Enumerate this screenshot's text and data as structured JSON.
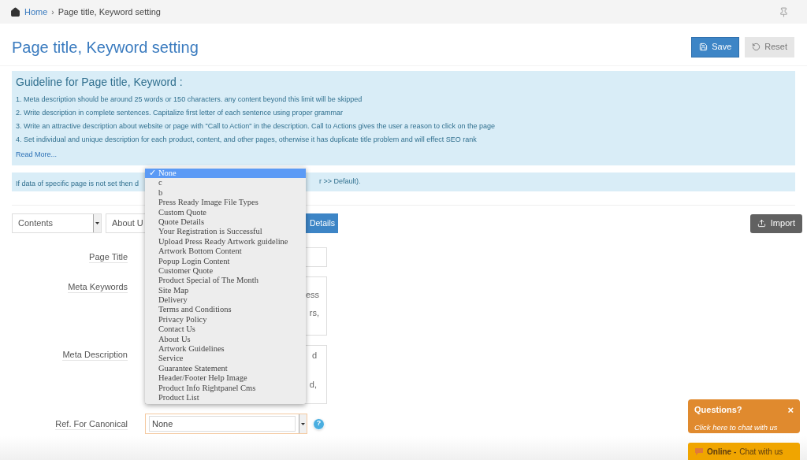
{
  "breadcrumb": {
    "home": "Home",
    "separator": "›",
    "current": "Page title, Keyword setting"
  },
  "title": "Page title, Keyword setting",
  "buttons": {
    "save": "Save",
    "reset": "Reset",
    "import": "Import",
    "details": "Details"
  },
  "guideline": {
    "heading": "Guideline for Page title, Keyword :",
    "items": [
      "1. Meta description should be around 25 words or 150 characters. any content beyond this limit will be skipped",
      "2. Write description in complete sentences. Capitalize first letter of each sentence using proper grammar",
      "3. Write an attractive description about website or page with \"Call to Action\" in the description. Call to Actions gives the user a reason to click on the page",
      "4. Set individual and unique description for each product, content, and other pages, otherwise it has duplicate title problem and will effect SEO rank"
    ],
    "read_more": "Read More..."
  },
  "info": {
    "text_start": "If data of specific page is not set then d",
    "text_end": "r >> Default)."
  },
  "filters": {
    "type_select": "Contents",
    "page_select": "About U"
  },
  "form": {
    "page_title_label": "Page Title",
    "meta_keywords_label": "Meta Keywords",
    "meta_keywords_lines": [
      "ess",
      "rs,"
    ],
    "meta_description_label": "Meta Description",
    "meta_description_lines": [
      "d",
      "d,"
    ],
    "canonical_label": "Ref. For Canonical",
    "canonical_value": "None",
    "help": "?"
  },
  "dropdown": {
    "check": "✓",
    "options": [
      {
        "label": "None",
        "selected": true
      },
      {
        "label": "c",
        "selected": false
      },
      {
        "label": "b",
        "selected": false
      },
      {
        "label": "Press Ready Image File Types",
        "selected": false
      },
      {
        "label": "Custom Quote",
        "selected": false
      },
      {
        "label": "Quote Details",
        "selected": false
      },
      {
        "label": "Your Registration is Successful",
        "selected": false
      },
      {
        "label": "Upload Press Ready Artwork guideline",
        "selected": false
      },
      {
        "label": "Artwork Bottom Content",
        "selected": false
      },
      {
        "label": "Popup Login Content",
        "selected": false
      },
      {
        "label": "Customer Quote",
        "selected": false
      },
      {
        "label": "Product Special of The Month",
        "selected": false
      },
      {
        "label": "Site Map",
        "selected": false
      },
      {
        "label": "Delivery",
        "selected": false
      },
      {
        "label": "Terms and Conditions",
        "selected": false
      },
      {
        "label": "Privacy Policy",
        "selected": false
      },
      {
        "label": "Contact Us",
        "selected": false
      },
      {
        "label": "About Us",
        "selected": false
      },
      {
        "label": "Artwork Guidelines",
        "selected": false
      },
      {
        "label": "Service",
        "selected": false
      },
      {
        "label": "Guarantee Statement",
        "selected": false
      },
      {
        "label": "Header/Footer Help Image",
        "selected": false
      },
      {
        "label": "Product Info Rightpanel Cms",
        "selected": false
      },
      {
        "label": "Product List",
        "selected": false
      }
    ]
  },
  "chat": {
    "question": "Questions?",
    "close": "×",
    "prompt": "Click here to chat with us",
    "status": "Online -",
    "status_text": "Chat with us"
  }
}
